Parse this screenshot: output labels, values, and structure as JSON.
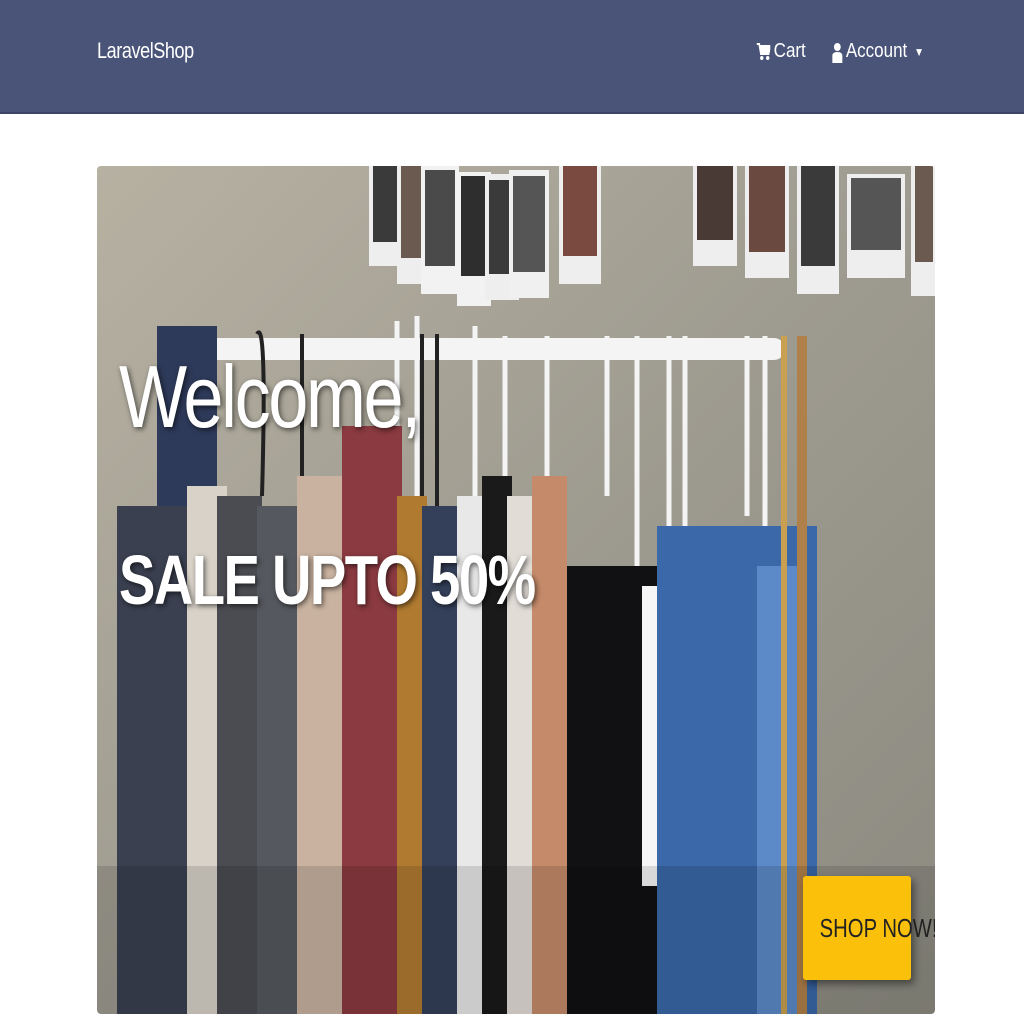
{
  "navbar": {
    "brand": "LaravelShop",
    "cart_label": "Cart",
    "account_label": "Account",
    "background_color": "#4a5478"
  },
  "hero": {
    "heading": "Welcome,",
    "subheading": "SALE UPTO 50%",
    "cta_label": "SHOP NOW!",
    "cta_color": "#fbc10a"
  },
  "icons": {
    "cart": "cart-icon",
    "account": "user-icon",
    "dropdown": "caret-down-icon"
  }
}
